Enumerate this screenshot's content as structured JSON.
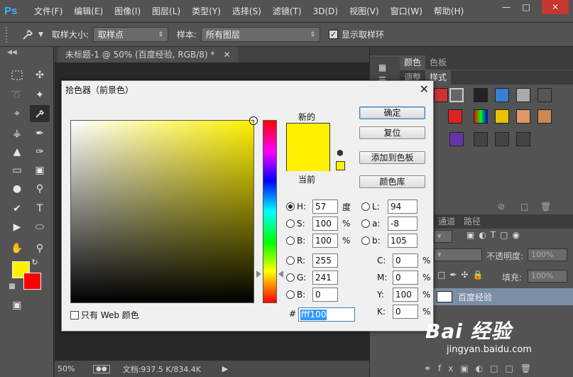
{
  "app": {
    "logo": "Ps"
  },
  "menu": [
    "文件(F)",
    "编辑(E)",
    "图像(I)",
    "图层(L)",
    "类型(Y)",
    "选择(S)",
    "滤镜(T)",
    "3D(D)",
    "视图(V)",
    "窗口(W)",
    "帮助(H)"
  ],
  "options": {
    "sample_size_label": "取样大小:",
    "sample_size_value": "取样点",
    "sample_label": "样本:",
    "sample_value": "所有图层",
    "show_ring_label": "显示取样环",
    "show_ring_checked": true
  },
  "document": {
    "tab_title": "未标题-1 @ 50% (百度经验, RGB/8) *",
    "zoom": "50%",
    "doc_info": "文档:937.5 K/834.4K"
  },
  "panels": {
    "tab_color": "颜色",
    "tab_swatches": "色板",
    "tab_adjust": "调整",
    "tab_styles": "样式",
    "tab_channels": "通道",
    "tab_paths": "路径",
    "opacity_label": "不透明度:",
    "opacity_value": "100%",
    "fill_label": "填充:",
    "fill_value": "100%",
    "layer_name": "百度经验"
  },
  "dialog": {
    "title": "拾色器（前景色）",
    "new_label": "新的",
    "current_label": "当前",
    "new_color": "#fff100",
    "current_color": "#fff100",
    "buttons": {
      "ok": "确定",
      "reset": "复位",
      "add_swatch": "添加到色板",
      "libraries": "颜色库"
    },
    "fields": {
      "H": "57",
      "S": "100",
      "B": "100",
      "R": "255",
      "G": "241",
      "Bb": "0",
      "L": "94",
      "a": "-8",
      "b": "105",
      "C": "0",
      "M": "0",
      "Y": "100",
      "K": "0"
    },
    "labels": {
      "H": "H:",
      "S": "S:",
      "B": "B:",
      "R": "R:",
      "G": "G:",
      "Bb": "B:",
      "L": "L:",
      "a": "a:",
      "b": "b:",
      "C": "C:",
      "M": "M:",
      "Y": "Y:",
      "K": "K:"
    },
    "units": {
      "deg": "度",
      "pct": "%"
    },
    "hex_hash": "#",
    "hex": "fff100",
    "web_only_label": "只有 Web 颜色"
  },
  "colors": {
    "foreground": "#fff100",
    "background": "#ff0000"
  },
  "watermark": {
    "main": "Bai 经验",
    "sub": "jingyan.baidu.com"
  }
}
